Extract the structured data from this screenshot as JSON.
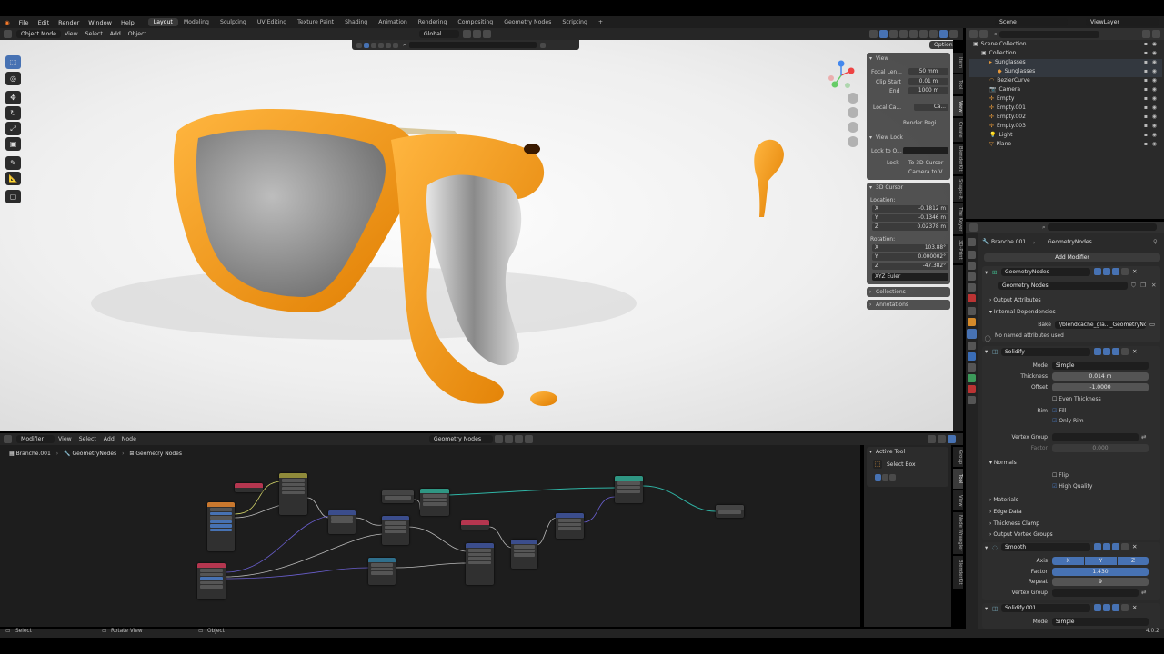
{
  "menu": [
    "File",
    "Edit",
    "Render",
    "Window",
    "Help"
  ],
  "workspaces": [
    "Layout",
    "Modeling",
    "Sculpting",
    "UV Editing",
    "Texture Paint",
    "Shading",
    "Animation",
    "Rendering",
    "Compositing",
    "Geometry Nodes",
    "Scripting"
  ],
  "active_workspace": "Layout",
  "scene": {
    "name": "Scene",
    "view_layer": "ViewLayer"
  },
  "viewport_header": {
    "mode": "Object Mode",
    "items": [
      "View",
      "Select",
      "Add",
      "Object"
    ],
    "transform": "Global",
    "options": "Options"
  },
  "npanel": {
    "view_title": "View",
    "focal_label": "Focal Len...",
    "focal_value": "50 mm",
    "clip_start_label": "Clip Start",
    "clip_start_value": "0.01 m",
    "end_label": "End",
    "end_value": "1000 m",
    "local_camera_label": "Local Ca...",
    "local_camera_value": "Ca...",
    "render_region": "Render Regi...",
    "view_lock_title": "View Lock",
    "lock_to_object_label": "Lock to O...",
    "lock_label": "Lock",
    "to_3d_cursor": "To 3D Cursor",
    "camera_to_view": "Camera to V...",
    "cursor_title": "3D Cursor",
    "location_label": "Location:",
    "loc_x_label": "X",
    "loc_x": "-0.1812 m",
    "loc_y_label": "Y",
    "loc_y": "-0.1346 m",
    "loc_z_label": "Z",
    "loc_z": "0.02378 m",
    "rotation_label": "Rotation:",
    "rot_x_label": "X",
    "rot_x": "103.88°",
    "rot_y_label": "Y",
    "rot_y": "0.000002°",
    "rot_z_label": "Z",
    "rot_z": "-47.382°",
    "rotation_mode": "XYZ Euler",
    "collections": "Collections",
    "annotations": "Annotations"
  },
  "viewport_tabs": [
    "Item",
    "Tool",
    "View",
    "Create",
    "BlenderKit",
    "Shape-it",
    "The Keyer",
    "3D-Print"
  ],
  "outliner": {
    "search_placeholder": "",
    "rows": [
      {
        "label": "Scene Collection",
        "indent": 0
      },
      {
        "label": "Collection",
        "indent": 1
      },
      {
        "label": "Sunglasses",
        "indent": 2
      },
      {
        "label": "Sunglasses",
        "indent": 3
      },
      {
        "label": "BezierCurve",
        "indent": 2
      },
      {
        "label": "Camera",
        "indent": 2
      },
      {
        "label": "Empty",
        "indent": 2
      },
      {
        "label": "Empty.001",
        "indent": 2
      },
      {
        "label": "Empty.002",
        "indent": 2
      },
      {
        "label": "Empty.003",
        "indent": 2
      },
      {
        "label": "Light",
        "indent": 2
      },
      {
        "label": "Plane",
        "indent": 2
      }
    ]
  },
  "properties": {
    "object_name": "Branche.001",
    "modifier_context": "GeometryNodes",
    "add_modifier": "Add Modifier",
    "geonodes_modifier": "GeometryNodes",
    "node_group": "Geometry Nodes",
    "output_attributes": "Output Attributes",
    "internal_dependencies": "Internal Dependencies",
    "bake_label": "Bake",
    "bake_path": "//blendcache_gla..._GeometryNodes",
    "no_named_attributes": "No named attributes used",
    "solidify": {
      "name": "Solidify",
      "mode_label": "Mode",
      "mode_value": "Simple",
      "thickness_label": "Thickness",
      "thickness_value": "0.014 m",
      "offset_label": "Offset",
      "offset_value": "-1.0000",
      "even_thickness": "Even Thickness",
      "rim_label": "Rim",
      "fill": "Fill",
      "only_rim": "Only Rim",
      "vertex_group_label": "Vertex Group",
      "factor_label": "Factor",
      "factor_value": "0.000",
      "normals": "Normals",
      "flip": "Flip",
      "high_quality": "High Quality",
      "materials": "Materials",
      "edge_data": "Edge Data",
      "thickness_clamp": "Thickness Clamp",
      "output_vertex_groups": "Output Vertex Groups"
    },
    "smooth": {
      "name": "Smooth",
      "axis_label": "Axis",
      "axis_x": "X",
      "axis_y": "Y",
      "axis_z": "Z",
      "factor_label": "Factor",
      "factor_value": "1.430",
      "repeat_label": "Repeat",
      "repeat_value": "9",
      "vertex_group_label": "Vertex Group"
    },
    "solidify2": {
      "name": "Solidify.001",
      "mode_label": "Mode",
      "mode_value": "Simple"
    }
  },
  "node_editor": {
    "editor_type": "Modifier",
    "menu": [
      "View",
      "Select",
      "Add",
      "Node"
    ],
    "tree_name": "Geometry Nodes",
    "breadcrumb": [
      "Branche.001",
      "GeometryNodes",
      "Geometry Nodes"
    ],
    "active_tool_title": "Active Tool",
    "active_tool": "Select Box",
    "side_tabs": [
      "Group",
      "Tool",
      "View",
      "Node Wrangler",
      "BlenderKit"
    ]
  },
  "statusbar": {
    "left": "Select",
    "mid": "Rotate View",
    "right": "Object",
    "version": "4.0.2"
  },
  "colors": {
    "accent": "#4772b3",
    "sunglasses_frame": "#f0a020",
    "panel": "#282828",
    "header": "#303030"
  }
}
